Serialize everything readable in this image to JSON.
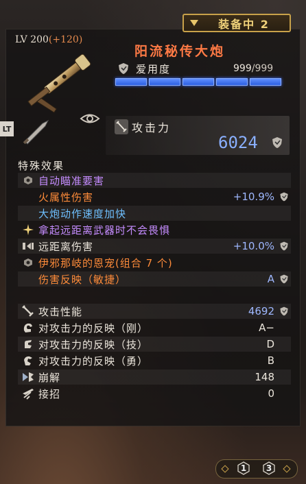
{
  "equip_status": "装备中 2",
  "level": {
    "base": "LV 200",
    "bonus": "(+120)"
  },
  "weapon": {
    "name": "阳流秘传大炮"
  },
  "affinity": {
    "label": "爱用度",
    "value": "999",
    "max": "/999",
    "segments": 5,
    "filled": 5
  },
  "side_button": "LT",
  "attack": {
    "label": "攻击力",
    "value": "6024"
  },
  "special_effects": {
    "title": "特殊效果",
    "rows": [
      {
        "icon": "hex-gem-icon",
        "text": "自动瞄准要害",
        "value": "",
        "color": "#c58cff"
      },
      {
        "icon": "",
        "text": "火属性伤害",
        "value": "+10.9%",
        "color": "#ff8c3a"
      },
      {
        "icon": "",
        "text": "大炮动作速度加快",
        "value": "",
        "color": "#6fc0ff"
      },
      {
        "icon": "sparkle-icon",
        "text": "拿起远距离武器时不会畏惧",
        "value": "",
        "color": "#c58cff"
      },
      {
        "icon": "bow-icon",
        "text": "远距离伤害",
        "value": "+10.0%",
        "color": "#ece6dc"
      },
      {
        "icon": "hex-gem-icon",
        "text": "伊邪那岐的恩宠(组合 7 个)",
        "value": "",
        "color": "#ff8c3a"
      },
      {
        "icon": "",
        "text": "伤害反映（敏捷）",
        "value": "A",
        "color": "#ff8c3a"
      }
    ]
  },
  "stats": [
    {
      "icon": "sword-icon",
      "text": "攻击性能",
      "value": "4692"
    },
    {
      "icon": "strength-fist-icon",
      "text": "对攻击力的反映（刚）",
      "value": "A−"
    },
    {
      "icon": "skill-hand-icon",
      "text": "对攻击力的反映（技）",
      "value": "D"
    },
    {
      "icon": "courage-icon",
      "text": "对攻击力的反映（勇）",
      "value": "B"
    },
    {
      "icon": "break-icon",
      "text": "崩解",
      "value": "148"
    },
    {
      "icon": "parry-icon",
      "text": "接招",
      "value": "0"
    }
  ],
  "pager": {
    "page1": "1",
    "page2": "3"
  },
  "colors": {
    "accent_gold": "#c9a24a",
    "affinity_blue": "#3e6fff",
    "value_blue": "#8ab0ff",
    "name_orange": "#ff7a45"
  }
}
